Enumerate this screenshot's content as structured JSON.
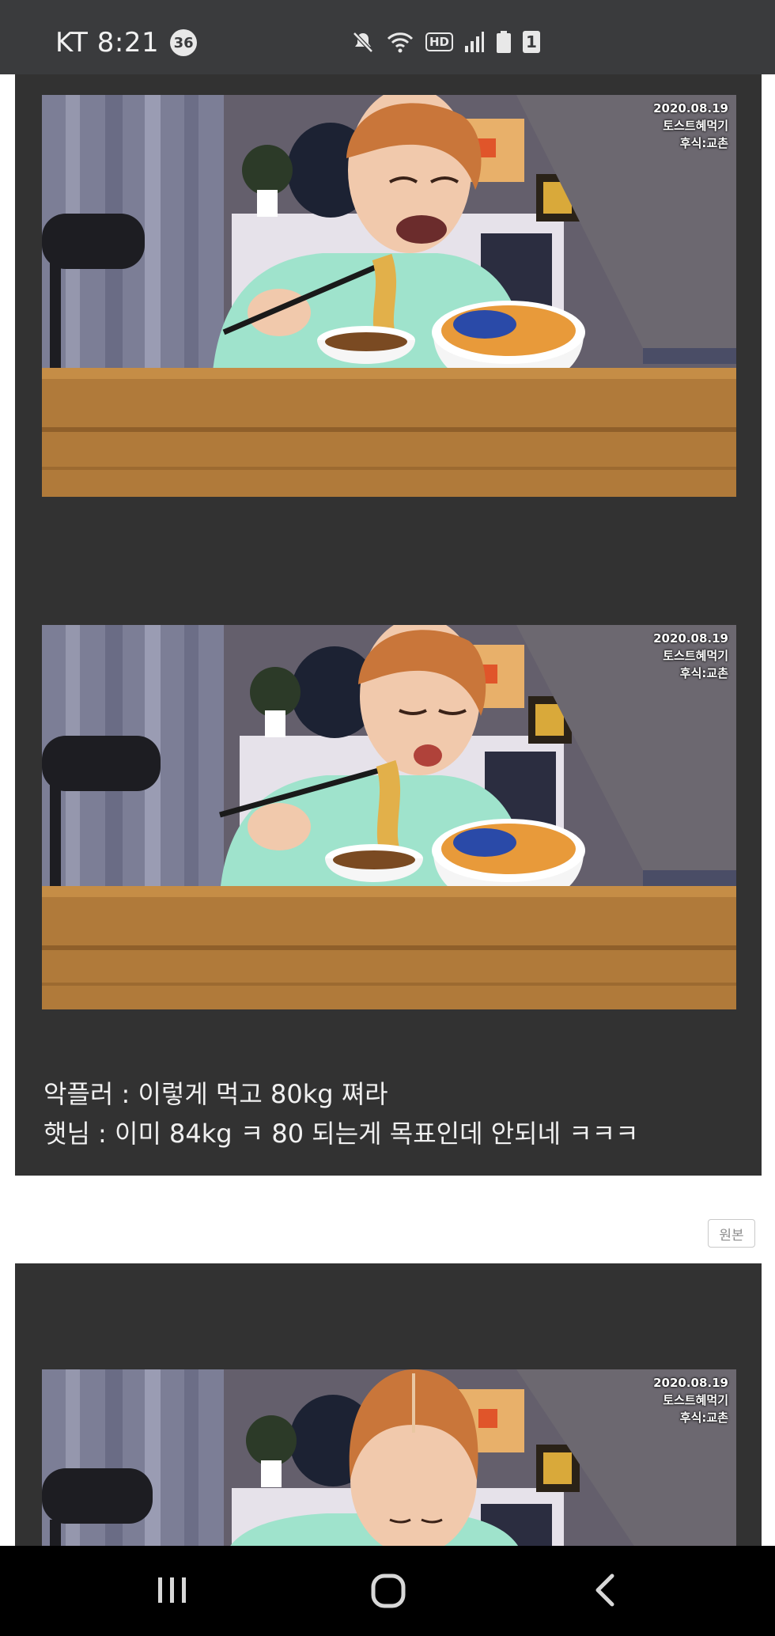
{
  "status_bar": {
    "carrier_time": "KT 8:21",
    "notification_count": "36",
    "hd_label": "HD",
    "battery_level": "1"
  },
  "post": {
    "photos": [
      {
        "stamp_date": "2020.08.19",
        "stamp_line2": "토스트혜먹기",
        "stamp_line3": "후식:교촌"
      },
      {
        "stamp_date": "2020.08.19",
        "stamp_line2": "토스트혜먹기",
        "stamp_line3": "후식:교촌"
      },
      {
        "stamp_date": "2020.08.19",
        "stamp_line2": "토스트혜먹기",
        "stamp_line3": "후식:교촌"
      }
    ],
    "caption_line1": "악플러 : 이렇게 먹고 80kg 쪄라",
    "caption_line2": "햇님 : 이미 84kg ㅋ 80 되는게 목표인데 안되네 ㅋㅋㅋ",
    "original_button": "원본"
  },
  "nav_bar": {
    "recents_icon": "recents-icon",
    "home_icon": "home-icon",
    "back_icon": "back-icon"
  },
  "colors": {
    "status_bar_bg": "#3a3b3d",
    "card_bg": "#323232",
    "nav_bar_bg": "#000000",
    "shirt": "#9fe3cc",
    "table_wood": "#b07a3a"
  }
}
